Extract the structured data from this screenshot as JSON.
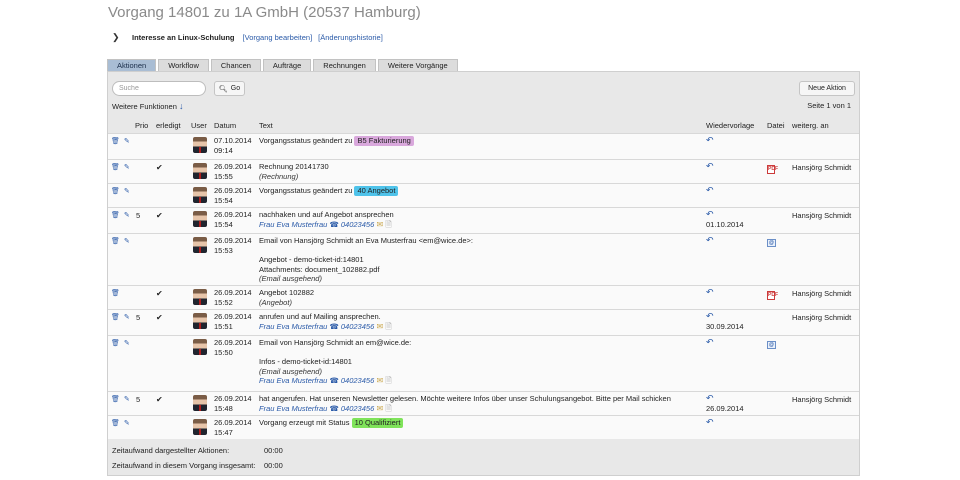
{
  "title": "Vorgang 14801 zu 1A GmbH (20537 Hamburg)",
  "subheader": {
    "toggle_icon": "chevron-down-icon",
    "topic": "Interesse an Linux-Schulung",
    "edit_link": "[Vorgang bearbeiten]",
    "history_link": "[Änderungshistorie]"
  },
  "tabs": [
    {
      "label": "Aktionen",
      "active": true
    },
    {
      "label": "Workflow",
      "active": false
    },
    {
      "label": "Chancen",
      "active": false
    },
    {
      "label": "Aufträge",
      "active": false
    },
    {
      "label": "Rechnungen",
      "active": false
    },
    {
      "label": "Weitere Vorgänge",
      "active": false
    }
  ],
  "toolbar": {
    "search_placeholder": "Suche",
    "go_label": "Go",
    "new_action_label": "Neue Aktion",
    "more_functions": "Weitere Funktionen",
    "pager": "Seite 1 von 1"
  },
  "columns": {
    "prio": "Prio",
    "done": "erledigt",
    "user": "User",
    "date": "Datum",
    "text": "Text",
    "resubmission": "Wiedervorlage",
    "file": "Datei",
    "forwarded": "weiterg. an"
  },
  "rows": [
    {
      "height": 26,
      "prio": "",
      "done": false,
      "date": "07.10.2014",
      "time": "09:14",
      "lines": [
        {
          "type": "badge",
          "text": "Vorgangsstatus geändert zu ",
          "badge": "B5 Fakturierung",
          "color": "#d9a8dc"
        }
      ],
      "resub": "",
      "file": "",
      "fwd": ""
    },
    {
      "height": 24,
      "prio": "",
      "done": true,
      "date": "26.09.2014",
      "time": "15:55",
      "lines": [
        {
          "type": "plain",
          "text": "Rechnung 20141730"
        },
        {
          "type": "sub",
          "text": "(Rechnung)"
        }
      ],
      "resub": "",
      "file": "pdf",
      "fwd": "Hansjörg Schmidt"
    },
    {
      "height": 24,
      "prio": "",
      "done": false,
      "date": "26.09.2014",
      "time": "15:54",
      "lines": [
        {
          "type": "badge",
          "text": "Vorgangsstatus geändert zu ",
          "badge": "40 Angebot",
          "color": "#4fc3ea"
        }
      ],
      "resub": "",
      "file": "",
      "fwd": ""
    },
    {
      "height": 26,
      "prio": "5",
      "done": true,
      "date": "26.09.2014",
      "time": "15:54",
      "lines": [
        {
          "type": "plain",
          "text": "nachhaken und auf Angebot ansprechen"
        },
        {
          "type": "contact",
          "name": "Frau Eva Musterfrau",
          "phone": "04023456"
        }
      ],
      "resub": "01.10.2014",
      "file": "",
      "fwd": "Hansjörg Schmidt"
    },
    {
      "height": 52,
      "prio": "",
      "done": false,
      "date": "26.09.2014",
      "time": "15:53",
      "lines": [
        {
          "type": "plain",
          "text": "Email von Hansjörg Schmidt an Eva Musterfrau <em@wice.de>:"
        },
        {
          "type": "blank",
          "text": ""
        },
        {
          "type": "plain",
          "text": "Angebot - demo-ticket-id:14801"
        },
        {
          "type": "plain",
          "text": "Attachments: document_102882.pdf"
        },
        {
          "type": "sub",
          "text": "(Email ausgehend)"
        }
      ],
      "resub": "",
      "file": "eml",
      "fwd": ""
    },
    {
      "height": 24,
      "prio": "",
      "done": true,
      "date": "26.09.2014",
      "time": "15:52",
      "lines": [
        {
          "type": "plain",
          "text": "Angebot 102882"
        },
        {
          "type": "sub",
          "text": "(Angebot)"
        }
      ],
      "resub": "",
      "file": "pdf",
      "fwd": "Hansjörg Schmidt"
    },
    {
      "height": 26,
      "prio": "5",
      "done": true,
      "date": "26.09.2014",
      "time": "15:51",
      "lines": [
        {
          "type": "plain",
          "text": "anrufen und auf Mailing ansprechen."
        },
        {
          "type": "contact",
          "name": "Frau Eva Musterfrau",
          "phone": "04023456"
        }
      ],
      "resub": "30.09.2014",
      "file": "",
      "fwd": "Hansjörg Schmidt"
    },
    {
      "height": 56,
      "prio": "",
      "done": false,
      "date": "26.09.2014",
      "time": "15:50",
      "lines": [
        {
          "type": "plain",
          "text": "Email von Hansjörg Schmidt an em@wice.de:"
        },
        {
          "type": "blank",
          "text": ""
        },
        {
          "type": "plain",
          "text": "Infos - demo-ticket-id:14801"
        },
        {
          "type": "sub",
          "text": "(Email ausgehend)"
        },
        {
          "type": "contact",
          "name": "Frau Eva Musterfrau",
          "phone": "04023456"
        }
      ],
      "resub": "",
      "file": "eml",
      "fwd": ""
    },
    {
      "height": 24,
      "prio": "5",
      "done": true,
      "date": "26.09.2014",
      "time": "15:48",
      "lines": [
        {
          "type": "plain",
          "text": "hat angerufen. Hat unseren Newsletter gelesen. Möchte weitere Infos über unser Schulungsangebot. Bitte per Mail schicken"
        },
        {
          "type": "contact",
          "name": "Frau Eva Musterfrau",
          "phone": "04023456"
        }
      ],
      "resub": "26.09.2014",
      "file": "",
      "fwd": "Hansjörg Schmidt"
    },
    {
      "height": 24,
      "prio": "",
      "done": false,
      "date": "26.09.2014",
      "time": "15:47",
      "lines": [
        {
          "type": "badge",
          "text": "Vorgang erzeugt mit Status ",
          "badge": "10 Qualifiziert",
          "color": "#7fe35a"
        }
      ],
      "resub": "",
      "file": "",
      "fwd": ""
    }
  ],
  "footer": {
    "shown_label": "Zeitaufwand dargestellter Aktionen:",
    "shown_value": "00:00",
    "total_label": "Zeitaufwand in diesem Vorgang insgesamt:",
    "total_value": "00:00"
  },
  "icons": {
    "delete": "trash-icon",
    "edit": "edit-icon",
    "done": "checkmark-icon",
    "reply": "reply-arrow-icon",
    "phone": "phone-icon",
    "mail": "envelope-icon",
    "note": "note-icon",
    "pdf": "pdf-file-icon",
    "eml": "email-file-icon",
    "search": "magnifier-icon",
    "more": "arrow-down-icon"
  }
}
